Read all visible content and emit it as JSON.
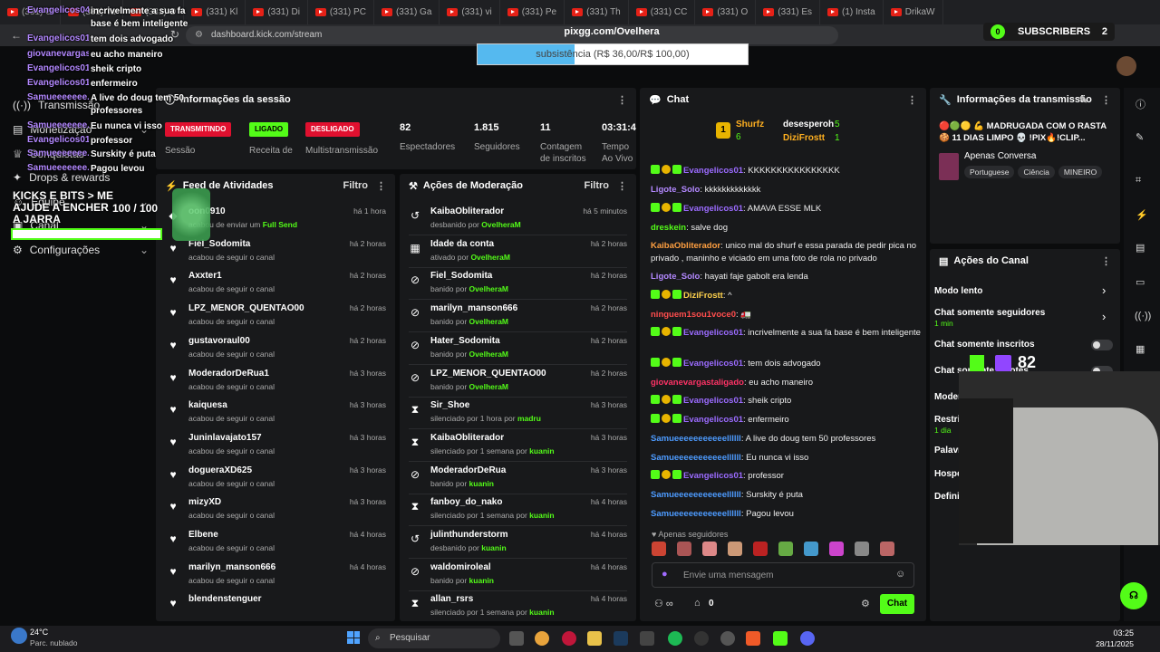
{
  "tabs": [
    "(331) O",
    "(331) Ta",
    "(331) O",
    "(331) Kl",
    "(331) Di",
    "(331) PC",
    "(331) Ga",
    "(331) vi",
    "(331) Pe",
    "(331) Th",
    "(331) CC",
    "(331) O",
    "(331) Es",
    "(1) Insta",
    "DrikaW"
  ],
  "url": "dashboard.kick.com/stream",
  "overlay": {
    "title": "pixgg.com/Ovelhera",
    "goal_text": "subsistência (R$ 36,00/R$ 100,00)",
    "goal_progress": 0.36,
    "subs_label": "SUBSCRIBERS",
    "subs_count": "2",
    "kicks_text": "KICKS E BITS > ME AJUDE A ENCHER A JARRA",
    "kicks_count": "100 / 100",
    "kick_count_right": "82"
  },
  "sidebar": {
    "items": [
      {
        "label": "Transmissão",
        "icon": "broadcast-icon"
      },
      {
        "label": "Monetização",
        "icon": "money-icon"
      },
      {
        "label": "Conquistas",
        "icon": "trophy-icon"
      },
      {
        "label": "Drops & rewards",
        "icon": "gift-icon"
      },
      {
        "label": "Equipe",
        "icon": "team-icon"
      },
      {
        "label": "Canal",
        "icon": "channel-icon"
      },
      {
        "label": "Configurações",
        "icon": "gear-icon"
      }
    ]
  },
  "overlay_chat": [
    {
      "user": "Evangelicos04",
      "msg": "incrivelmente a sua fa base é bem inteligente"
    },
    {
      "user": "Evangelicos01",
      "msg": "tem dois advogado"
    },
    {
      "user": "giovanevargas...",
      "msg": "eu acho maneiro"
    },
    {
      "user": "Evangelicos01",
      "msg": "sheik cripto"
    },
    {
      "user": "Evangelicos01",
      "msg": "enfermeiro"
    },
    {
      "user": "Samueeeeeee...",
      "msg": "A live do doug tem 50 professores"
    },
    {
      "user": "Samueeeeeee...",
      "msg": "Eu nunca vi isso"
    },
    {
      "user": "Evangelicos01",
      "msg": "professor"
    },
    {
      "user": "Samueeeeeee...",
      "msg": "Surskity é puta"
    },
    {
      "user": "Samueeeeeee...",
      "msg": "Pagou levou"
    }
  ],
  "session": {
    "title": "Informações da sessão",
    "badges": [
      {
        "text": "TRANSMITINDO",
        "label": "Sessão"
      },
      {
        "text": "LIGADO",
        "label": "Receita de"
      },
      {
        "text": "DESLIGADO",
        "label": "Multistransmissão"
      }
    ],
    "stats": [
      {
        "value": "82",
        "label": "Espectadores"
      },
      {
        "value": "1.815",
        "label": "Seguidores"
      },
      {
        "value": "11",
        "label": "Contagem de inscritos"
      },
      {
        "value": "03:31:42",
        "label": "Tempo Ao Vivo"
      }
    ]
  },
  "feed": {
    "title": "Feed de Atividades",
    "filter": "Filtro",
    "items": [
      {
        "name": "oon0910",
        "sub": "acabou de enviar um",
        "hl": "Full Send",
        "time": "há 1 hora"
      },
      {
        "name": "Fiel_Sodomita",
        "sub": "acabou de seguir o canal",
        "time": "há 2 horas"
      },
      {
        "name": "Axxter1",
        "sub": "acabou de seguir o canal",
        "time": "há 2 horas"
      },
      {
        "name": "LPZ_MENOR_QUENTAO00",
        "sub": "acabou de seguir o canal",
        "time": "há 2 horas"
      },
      {
        "name": "gustavoraul00",
        "sub": "acabou de seguir o canal",
        "time": "há 2 horas"
      },
      {
        "name": "ModeradorDeRua1",
        "sub": "acabou de seguir o canal",
        "time": "há 3 horas"
      },
      {
        "name": "kaiquesa",
        "sub": "acabou de seguir o canal",
        "time": "há 3 horas"
      },
      {
        "name": "Juninlavajato157",
        "sub": "acabou de seguir o canal",
        "time": "há 3 horas"
      },
      {
        "name": "dogueraXD625",
        "sub": "acabou de seguir o canal",
        "time": "há 3 horas"
      },
      {
        "name": "mizyXD",
        "sub": "acabou de seguir o canal",
        "time": "há 3 horas"
      },
      {
        "name": "Elbene",
        "sub": "acabou de seguir o canal",
        "time": "há 4 horas"
      },
      {
        "name": "marilyn_manson666",
        "sub": "acabou de seguir o canal",
        "time": "há 4 horas"
      },
      {
        "name": "blendenstenguer",
        "sub": "",
        "time": ""
      }
    ]
  },
  "mod": {
    "title": "Ações de Moderação",
    "filter": "Filtro",
    "items": [
      {
        "icon": "unban-icon",
        "glyph": "↺",
        "name": "KaibaObliterador",
        "sub": "desbanido por",
        "by": "OvelheraM",
        "time": "há 5 minutos"
      },
      {
        "icon": "calendar-icon",
        "glyph": "▦",
        "name": "Idade da conta",
        "sub": "ativado por",
        "by": "OvelheraM",
        "time": "há 2 horas"
      },
      {
        "icon": "ban-icon",
        "glyph": "⊘",
        "name": "Fiel_Sodomita",
        "sub": "banido por",
        "by": "OvelheraM",
        "time": "há 2 horas"
      },
      {
        "icon": "ban-icon",
        "glyph": "⊘",
        "name": "marilyn_manson666",
        "sub": "banido por",
        "by": "OvelheraM",
        "time": "há 2 horas"
      },
      {
        "icon": "ban-icon",
        "glyph": "⊘",
        "name": "Hater_Sodomita",
        "sub": "banido por",
        "by": "OvelheraM",
        "time": "há 2 horas"
      },
      {
        "icon": "ban-icon",
        "glyph": "⊘",
        "name": "LPZ_MENOR_QUENTAO00",
        "sub": "banido por",
        "by": "OvelheraM",
        "time": "há 2 horas"
      },
      {
        "icon": "timeout-icon",
        "glyph": "⧗",
        "name": "Sir_Shoe",
        "sub": "silenciado por 1 hora por",
        "by": "madru",
        "time": "há 3 horas"
      },
      {
        "icon": "timeout-icon",
        "glyph": "⧗",
        "name": "KaibaObliterador",
        "sub": "silenciado por 1 semana por",
        "by": "kuanin",
        "time": "há 3 horas"
      },
      {
        "icon": "ban-icon",
        "glyph": "⊘",
        "name": "ModeradorDeRua",
        "sub": "banido por",
        "by": "kuanin",
        "time": "há 3 horas"
      },
      {
        "icon": "timeout-icon",
        "glyph": "⧗",
        "name": "fanboy_do_nako",
        "sub": "silenciado por 1 semana por",
        "by": "kuanin",
        "time": "há 4 horas"
      },
      {
        "icon": "unban-icon",
        "glyph": "↺",
        "name": "julinthunderstorm",
        "sub": "desbanido por",
        "by": "kuanin",
        "time": "há 4 horas"
      },
      {
        "icon": "ban-icon",
        "glyph": "⊘",
        "name": "waldomiroleal",
        "sub": "banido por",
        "by": "kuanin",
        "time": "há 4 horas"
      },
      {
        "icon": "timeout-icon",
        "glyph": "⧗",
        "name": "allan_rsrs",
        "sub": "silenciado por 1 semana por",
        "by": "kuanin",
        "time": "há 4 horas"
      }
    ]
  },
  "chat": {
    "title": "Chat",
    "top": [
      {
        "name": "Shurfz",
        "count": "6"
      },
      {
        "name": "desesperoh",
        "count": "5"
      },
      {
        "name": "DiziFrostt",
        "count": "1"
      }
    ],
    "messages": [
      {
        "user": "Evangelicos01",
        "color": "#9b6bff",
        "badges": true,
        "text": "KKKKKKKKKKKKKKKK"
      },
      {
        "user": "Ligote_Solo",
        "color": "#b388ff",
        "badges": false,
        "text": "kkkkkkkkkkkkk"
      },
      {
        "user": "Evangelicos01",
        "color": "#9b6bff",
        "badges": true,
        "text": "AMAVA ESSE MLK"
      },
      {
        "user": "dreskein",
        "color": "#53fc18",
        "badges": false,
        "text": "salve dog"
      },
      {
        "user": "KaibaObliterador",
        "color": "#ff9f40",
        "badges": false,
        "text": "unico mal do shurf e essa parada de pedir pica no privado , maninho e viciado em uma foto de rola no privado"
      },
      {
        "user": "Ligote_Solo",
        "color": "#b388ff",
        "badges": false,
        "text": "hayati faje gabolt era lenda"
      },
      {
        "user": "DiziFrostt",
        "color": "#ffd24d",
        "badges": true,
        "text": "^"
      },
      {
        "user": "ninguem1sou1voce0",
        "color": "#ff4d4d",
        "badges": false,
        "text": "🚛"
      },
      {
        "user": "Evangelicos01",
        "color": "#9b6bff",
        "badges": true,
        "text": "incrivelmente a sua fa base é bem inteligente"
      },
      {
        "user": "Evangelicos01",
        "color": "#9b6bff",
        "badges": true,
        "text": "tem dois advogado"
      },
      {
        "user": "giovanevargastaligado",
        "color": "#ff3366",
        "badges": false,
        "text": "eu acho maneiro"
      },
      {
        "user": "Evangelicos01",
        "color": "#9b6bff",
        "badges": true,
        "text": "sheik cripto"
      },
      {
        "user": "Evangelicos01",
        "color": "#9b6bff",
        "badges": true,
        "text": "enfermeiro"
      },
      {
        "user": "Samueeeeeeeeeeellllll",
        "color": "#4d9bff",
        "badges": false,
        "text": "A live do doug tem 50 professores"
      },
      {
        "user": "Samueeeeeeeeeeellllll",
        "color": "#4d9bff",
        "badges": false,
        "text": "Eu nunca vi isso"
      },
      {
        "user": "Evangelicos01",
        "color": "#9b6bff",
        "badges": true,
        "text": "professor"
      },
      {
        "user": "Samueeeeeeeeeeellllll",
        "color": "#4d9bff",
        "badges": false,
        "text": "Surskity é puta"
      },
      {
        "user": "Samueeeeeeeeeeellllll",
        "color": "#4d9bff",
        "badges": false,
        "text": "Pagou levou"
      }
    ],
    "followers_only": "Apenas seguidores",
    "placeholder": "Envie uma mensagem",
    "points": "0",
    "send": "Chat"
  },
  "stream_info": {
    "title": "Informações da transmissão",
    "stream_title": "🔴🟢🟡 💪 MADRUGADA COM O RASTA 🍪 11 DIAS LIMPO 💀 !PIX🔥!CLIP...",
    "category": "Apenas Conversa",
    "tags": [
      "Portuguese",
      "Ciência",
      "MINEIRO"
    ]
  },
  "channel_actions": {
    "title": "Ações do Canal",
    "rows": [
      {
        "label": "Modo lento",
        "sub": ""
      },
      {
        "label": "Chat somente seguidores",
        "sub": "1 min"
      },
      {
        "label": "Chat somente inscritos",
        "sub": ""
      },
      {
        "label": "Chat somente emotes",
        "sub": ""
      },
      {
        "label": "Moderação d",
        "sub": ""
      },
      {
        "label": "Restrição",
        "sub": "1 dia"
      },
      {
        "label": "Palavr",
        "sub": ""
      },
      {
        "label": "Hospe",
        "sub": ""
      },
      {
        "label": "Defini",
        "sub": ""
      }
    ]
  },
  "taskbar": {
    "weather_temp": "24°C",
    "weather_desc": "Parc. nublado",
    "search": "Pesquisar",
    "time": "03:25",
    "date": "28/11/2025"
  }
}
